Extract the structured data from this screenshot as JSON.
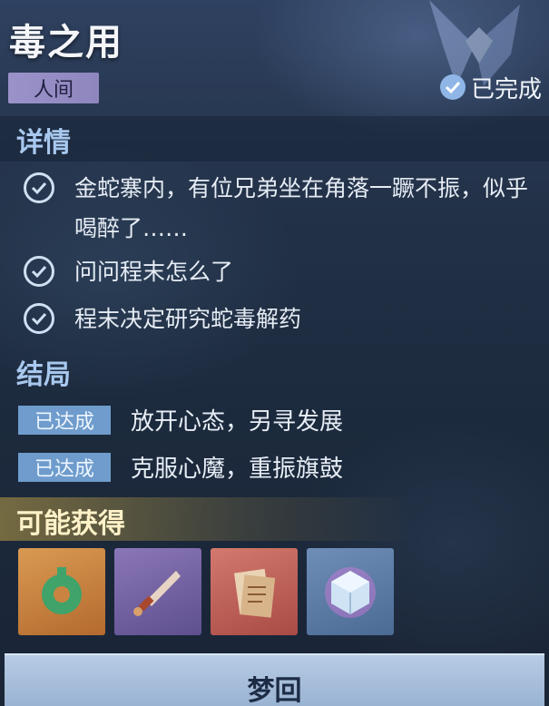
{
  "quest": {
    "title": "毒之用",
    "realm_tag": "人间",
    "status": "已完成"
  },
  "details": {
    "heading": "详情",
    "tasks": [
      {
        "text": "金蛇寨内，有位兄弟坐在角落一蹶不振，似乎喝醉了……",
        "done": true
      },
      {
        "text": "问问程末怎么了",
        "done": true
      },
      {
        "text": "程末决定研究蛇毒解药",
        "done": true
      }
    ]
  },
  "endings": {
    "heading": "结局",
    "items": [
      {
        "badge": "已达成",
        "text": "放开心态，另寻发展"
      },
      {
        "badge": "已达成",
        "text": "克服心魔，重振旗鼓"
      }
    ]
  },
  "rewards": {
    "heading": "可能获得",
    "items": [
      {
        "icon": "jade-ring-icon",
        "rarity": "orange"
      },
      {
        "icon": "dagger-icon",
        "rarity": "purple"
      },
      {
        "icon": "scroll-book-icon",
        "rarity": "red"
      },
      {
        "icon": "crystal-cube-icon",
        "rarity": "blue"
      }
    ]
  },
  "action": {
    "label": "梦回"
  },
  "colors": {
    "accent": "#a8c8ee",
    "badge": "#6f9ccc",
    "tag": "#9a92c9"
  }
}
